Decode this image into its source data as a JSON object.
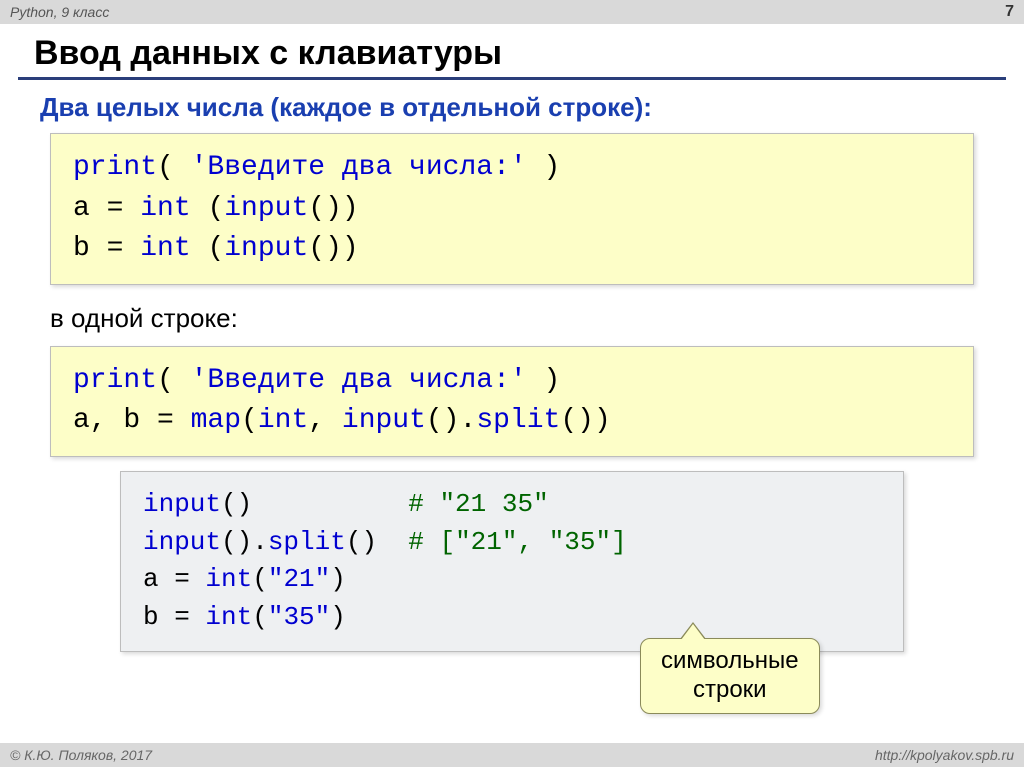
{
  "header": {
    "left": "Python, 9 класс",
    "page_number": "7"
  },
  "title": "Ввод данных с клавиатуры",
  "subtitle": "Два целых числа (каждое в отдельной строке):",
  "code1": {
    "line1a": "print",
    "line1b": "( ",
    "line1c": "'Введите два числа:'",
    "line1d": " )",
    "line2a": "a = ",
    "line2b": "int",
    "line2c": " (",
    "line2d": "input",
    "line2e": "())",
    "line3a": "b = ",
    "line3b": "int",
    "line3c": " (",
    "line3d": "input",
    "line3e": "())"
  },
  "interline": "в одной строке:",
  "code2": {
    "line1a": "print",
    "line1b": "( ",
    "line1c": "'Введите два числа:'",
    "line1d": " )",
    "line2a": "a, b = ",
    "line2b": "map",
    "line2c": "(",
    "line2d": "int",
    "line2e": ", ",
    "line2f": "input",
    "line2g": "().",
    "line2h": "split",
    "line2i": "())"
  },
  "code3": {
    "line1a": "input",
    "line1b": "()          ",
    "line1c": "# \"21 35\"",
    "line2a": "input",
    "line2b": "().",
    "line2c": "split",
    "line2d": "()  ",
    "line2e": "# [\"21\", \"35\"]",
    "line3a": "a = ",
    "line3b": "int",
    "line3c": "(",
    "line3d": "\"21\"",
    "line3e": ")",
    "line4a": "b = ",
    "line4b": "int",
    "line4c": "(",
    "line4d": "\"35\"",
    "line4e": ")"
  },
  "callout": {
    "line1": "символьные",
    "line2": "строки"
  },
  "footer": {
    "left": "© К.Ю. Поляков, 2017",
    "right": "http://kpolyakov.spb.ru"
  }
}
